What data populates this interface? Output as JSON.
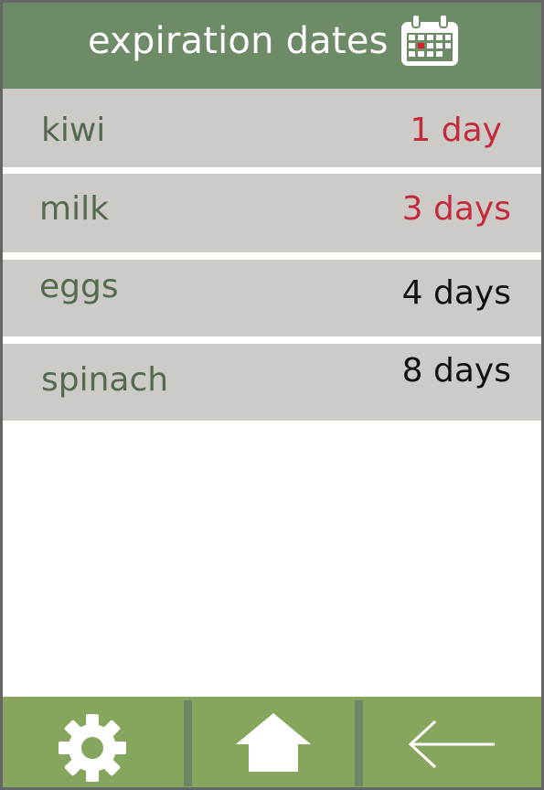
{
  "header": {
    "title": "expiration dates",
    "icon": "calendar-icon"
  },
  "items": [
    {
      "name": "kiwi",
      "days": "1 day",
      "urgent": true
    },
    {
      "name": "milk",
      "days": "3 days",
      "urgent": true
    },
    {
      "name": "eggs",
      "days": "4 days",
      "urgent": false
    },
    {
      "name": "spinach",
      "days": "8 days",
      "urgent": false
    }
  ],
  "footer": {
    "buttons": [
      "gear-icon",
      "home-icon",
      "back-arrow-icon"
    ]
  },
  "colors": {
    "header_bg": "#6e8b67",
    "footer_bg": "#86a55d",
    "row_bg": "#cccbc8",
    "item_text": "#55694f",
    "urgent": "#c42a3a",
    "normal": "#111111",
    "calendar_marker": "#d2232a"
  }
}
